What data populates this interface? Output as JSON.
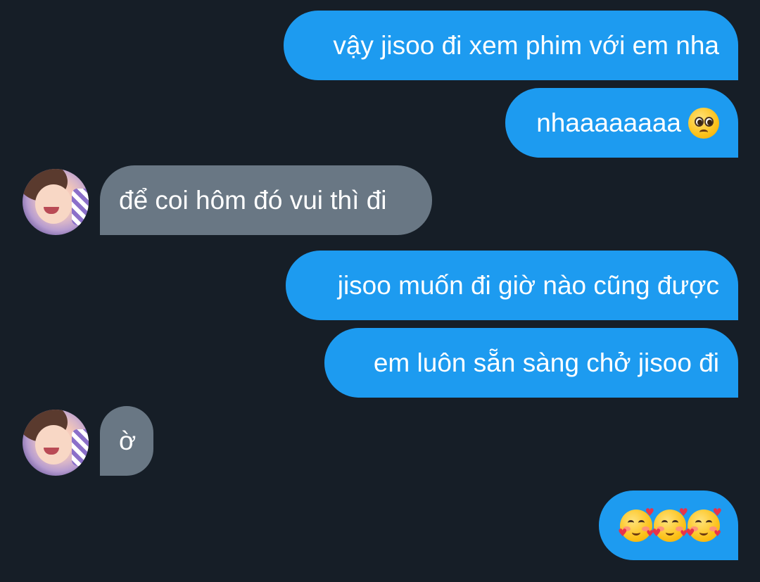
{
  "messages": [
    {
      "direction": "outgoing",
      "text": "vậy jisoo đi xem phim với em nha"
    },
    {
      "direction": "outgoing",
      "text": "nhaaaaaaaa",
      "emoji": "pleading-face-icon"
    },
    {
      "direction": "incoming",
      "text": "để coi hôm đó vui thì đi"
    },
    {
      "direction": "outgoing",
      "text": "jisoo muốn đi giờ nào cũng được"
    },
    {
      "direction": "outgoing",
      "text": "em luôn sẵn sàng chở jisoo đi"
    },
    {
      "direction": "incoming",
      "text": "ờ"
    },
    {
      "direction": "outgoing",
      "text": "",
      "emoji": "smiling-face-with-hearts-icon",
      "emoji_count": 3
    }
  ],
  "colors": {
    "background": "#161e27",
    "outgoing_bubble": "#1d9bf0",
    "incoming_bubble": "#697784",
    "text": "#ffffff"
  }
}
